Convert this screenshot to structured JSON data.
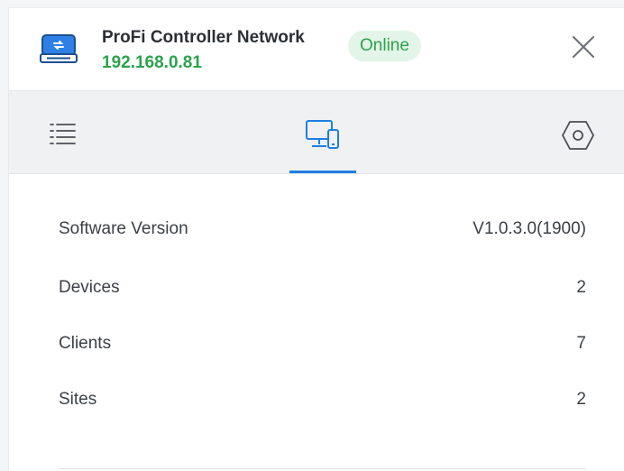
{
  "header": {
    "device_name": "ProFi Controller Network",
    "ip": "192.168.0.81",
    "status": "Online",
    "close_icon": "close-icon",
    "device_icon": "controller-device-icon"
  },
  "tabs": [
    {
      "name": "list",
      "icon": "list-icon",
      "active": false
    },
    {
      "name": "devices",
      "icon": "monitor-devices-icon",
      "active": true
    },
    {
      "name": "settings",
      "icon": "hexagon-settings-icon",
      "active": false
    }
  ],
  "info": {
    "rows": [
      {
        "label": "Software Version",
        "value": "V1.0.3.0(1900)"
      },
      {
        "label": "Devices",
        "value": "2"
      },
      {
        "label": "Clients",
        "value": "7"
      },
      {
        "label": "Sites",
        "value": "2"
      }
    ]
  },
  "colors": {
    "accent": "#1e7fe0",
    "online": "#2ca24c",
    "online_bg": "#e3f5e8"
  }
}
